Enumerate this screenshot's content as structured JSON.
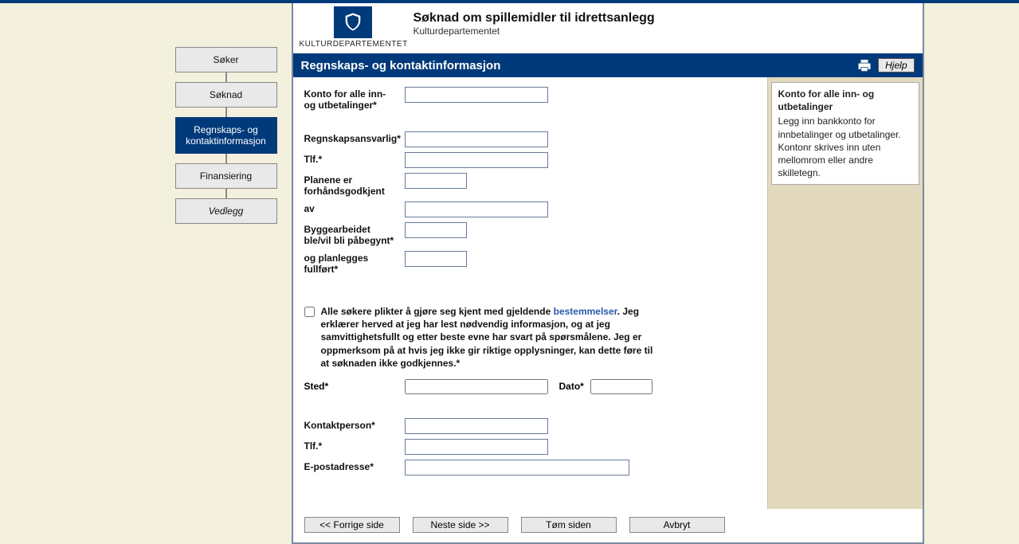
{
  "header": {
    "logo_text": "KULTURDEPARTEMENTET",
    "app_title": "Søknad om spillemidler til idrettsanlegg",
    "app_subtitle": "Kulturdepartementet"
  },
  "nav": {
    "steps": [
      {
        "label": "Søker"
      },
      {
        "label": "Søknad"
      },
      {
        "label": "Regnskaps- og kontaktinformasjon"
      },
      {
        "label": "Finansiering"
      },
      {
        "label": "Vedlegg"
      }
    ]
  },
  "section": {
    "title": "Regnskaps- og kontaktinformasjon",
    "help_label": "Hjelp"
  },
  "form": {
    "konto_label": "Konto for alle inn- og utbetalinger*",
    "konto_value": "",
    "regnskap_label": "Regnskapsansvarlig*",
    "regnskap_value": "",
    "tlf1_label": "Tlf.*",
    "tlf1_value": "",
    "plan_label": "Planene er forhåndsgodkjent",
    "plan_value": "",
    "av_label": "av",
    "av_value": "",
    "bygge_label": "Byggearbeidet ble/vil bli påbegynt*",
    "bygge_value": "",
    "fullfort_label": "og planlegges fullført*",
    "fullfort_value": "",
    "decl_pre": "Alle søkere plikter å gjøre seg kjent med gjeldende ",
    "decl_link": "bestemmelser",
    "decl_post": ". Jeg erklærer herved at jeg har lest nødvendig informasjon, og at jeg samvittighetsfullt og etter beste evne har svart på spørsmålene. Jeg er oppmerksom på at hvis jeg ikke gir riktige opplysninger, kan dette føre til at søknaden ikke godkjennes.*",
    "sted_label": "Sted*",
    "sted_value": "",
    "dato_label": "Dato*",
    "dato_value": "",
    "kontakt_label": "Kontaktperson*",
    "kontakt_value": "",
    "tlf2_label": "Tlf.*",
    "tlf2_value": "",
    "epost_label": "E-postadresse*",
    "epost_value": ""
  },
  "help": {
    "title": "Konto for alle inn- og utbetalinger",
    "body": "Legg inn bankkonto for innbetalinger og utbetalinger. Kontonr skrives inn uten mellomrom eller andre skilletegn."
  },
  "footer": {
    "prev": "<< Forrige side",
    "next": "Neste side >>",
    "clear": "Tøm siden",
    "cancel": "Avbryt"
  }
}
